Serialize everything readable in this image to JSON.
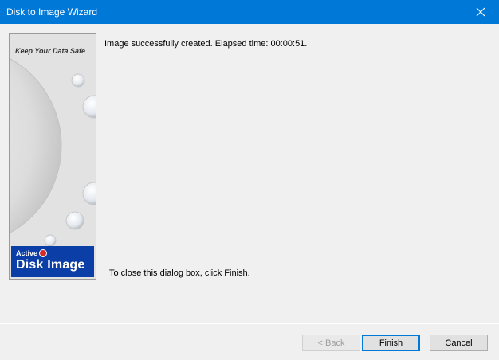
{
  "window": {
    "title": "Disk to Image Wizard"
  },
  "banner": {
    "tagline": "Keep Your Data Safe",
    "brand_small": "Active",
    "brand_big": "Disk Image"
  },
  "main": {
    "status_message": "Image successfully created. Elapsed time: 00:00:51.",
    "close_hint": "To close this dialog box, click Finish."
  },
  "buttons": {
    "back": "< Back",
    "finish": "Finish",
    "cancel": "Cancel"
  },
  "colors": {
    "titlebar": "#0078d7",
    "brand": "#0b3ea6"
  }
}
